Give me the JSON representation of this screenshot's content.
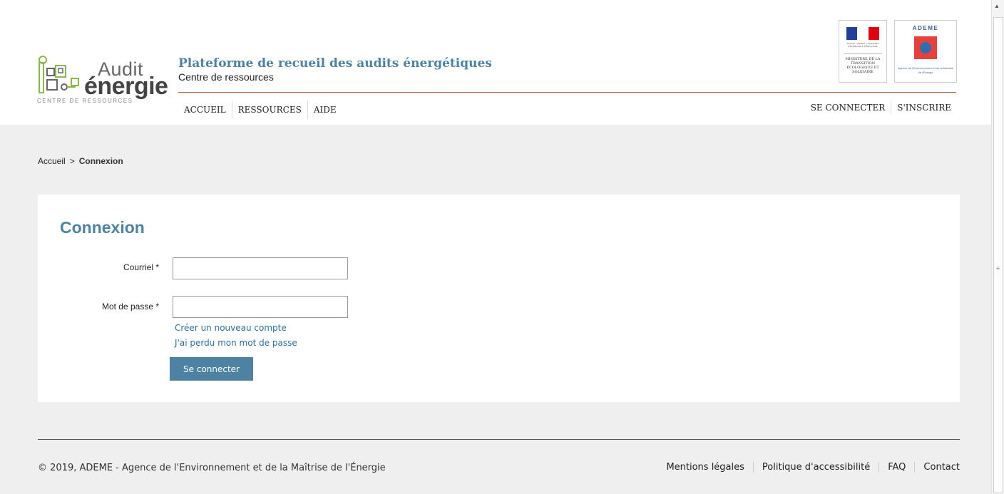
{
  "header": {
    "logo": {
      "audit": "Audit",
      "energie": "énergie",
      "subtitle": "CENTRE DE RESSOURCES"
    },
    "site_title": "Plateforme de recueil des audits énergétiques",
    "site_subtitle": "Centre de ressources",
    "nav": [
      {
        "label": "ACCUEIL"
      },
      {
        "label": "RESSOURCES"
      },
      {
        "label": "AIDE"
      }
    ],
    "account": {
      "login": "SE CONNECTER",
      "register": "S'INSCRIRE"
    },
    "gov_logo": {
      "motto": "Liberté • Égalité • Fraternité RÉPUBLIQUE FRANÇAISE",
      "name": "MINISTÈRE DE LA TRANSITION ÉCOLOGIQUE ET SOLIDAIRE"
    },
    "ademe_logo": {
      "word": "ADEME",
      "tagline": "Agence de l'Environnement et de la Maîtrise de l'Énergie"
    },
    "colors": {
      "accent": "#4d82a3",
      "rule": "#c75a2f"
    }
  },
  "breadcrumb": {
    "home": "Accueil",
    "separator": ">",
    "current": "Connexion"
  },
  "form": {
    "title": "Connexion",
    "email_label": "Courriel *",
    "email_value": "",
    "password_label": "Mot de passe *",
    "password_value": "",
    "create_account": "Créer un nouveau compte",
    "lost_password": "J'ai perdu mon mot de passe",
    "submit": "Se connecter"
  },
  "footer": {
    "copyright": "© 2019, ADEME - Agence de l'Environnement et de la Maîtrise de l'Énergie",
    "links": [
      {
        "label": "Mentions légales"
      },
      {
        "label": "Politique d'accessibilité"
      },
      {
        "label": "FAQ"
      },
      {
        "label": "Contact"
      }
    ]
  }
}
